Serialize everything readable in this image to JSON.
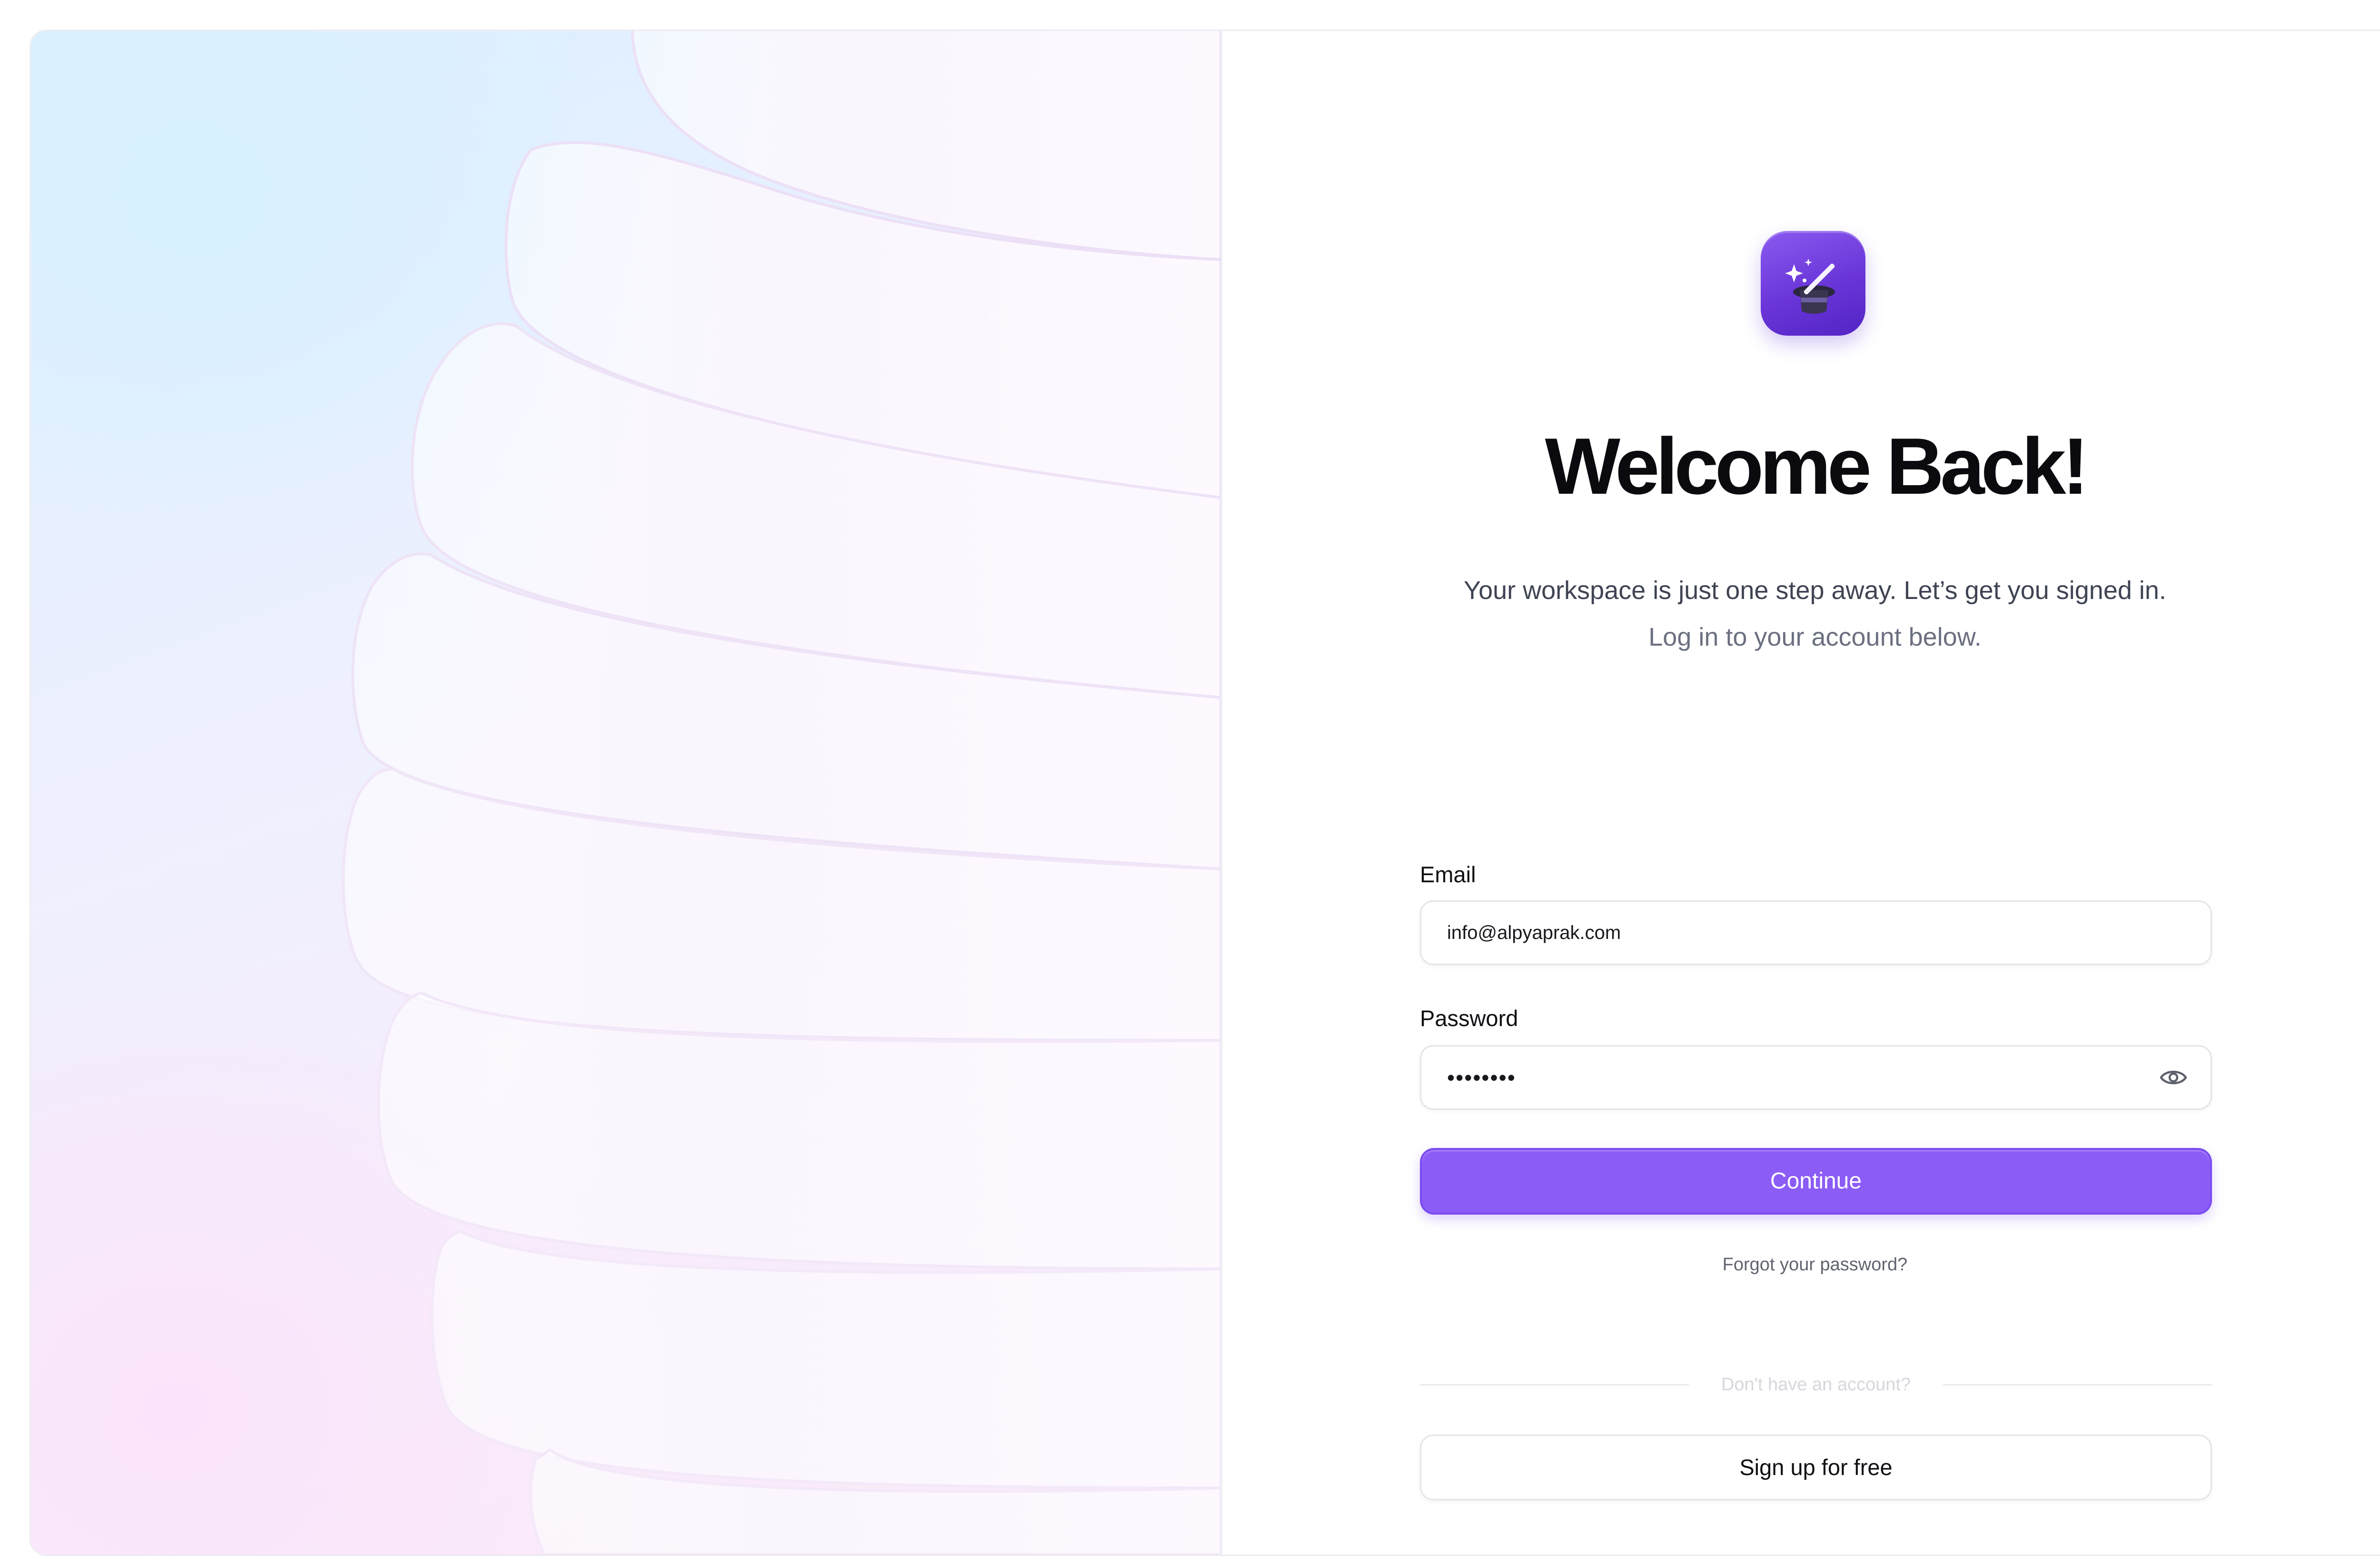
{
  "brand": {
    "icon": "magic-hat-wand-icon",
    "accent_color": "#8b5cf6"
  },
  "heading": {
    "title": "Welcome Back!",
    "subtitle_line1": "Your workspace is just one step away. Let’s get you signed in.",
    "subtitle_line2": "Log in to your account below."
  },
  "form": {
    "email_label": "Email",
    "email_value": "info@alpyaprak.com",
    "password_label": "Password",
    "password_masked": "••••••••",
    "password_toggle_icon": "eye-icon",
    "continue_label": "Continue",
    "forgot_label": "Forgot your password?"
  },
  "signup": {
    "divider_text": "Don't have an account?",
    "button_label": "Sign up for free"
  }
}
